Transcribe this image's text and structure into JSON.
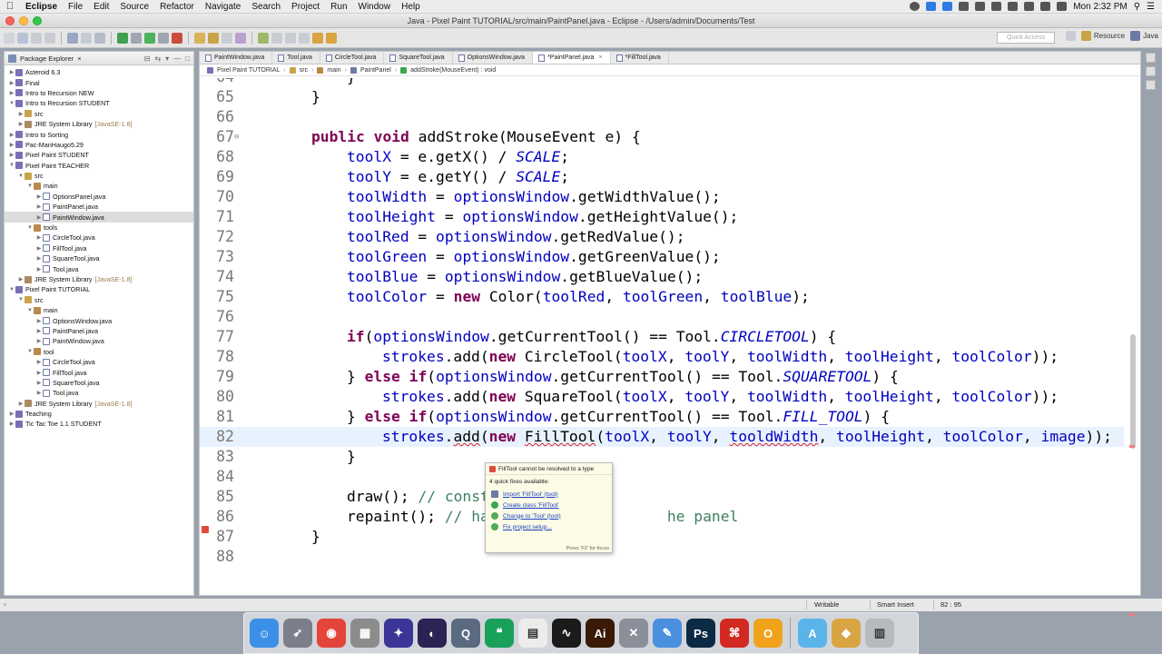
{
  "menubar": {
    "app_name": "Eclipse",
    "items": [
      "File",
      "Edit",
      "Source",
      "Refactor",
      "Navigate",
      "Search",
      "Project",
      "Run",
      "Window",
      "Help"
    ],
    "clock": "Mon 2:32 PM"
  },
  "window": {
    "title": "Java - Pixel Paint TUTORIAL/src/main/PaintPanel.java - Eclipse - /Users/admin/Documents/Test"
  },
  "toolbar": {
    "quick_access_placeholder": "Quick Access",
    "perspectives": [
      "Resource",
      "Java"
    ]
  },
  "explorer": {
    "title": "Package Explorer",
    "rows": [
      {
        "depth": 0,
        "arrow": "▶",
        "icon": "project",
        "label": "Asteroid 6.3"
      },
      {
        "depth": 0,
        "arrow": "▶",
        "icon": "project",
        "label": "Final"
      },
      {
        "depth": 0,
        "arrow": "▶",
        "icon": "project",
        "label": "Intro to Recursion NEW"
      },
      {
        "depth": 0,
        "arrow": "▼",
        "icon": "project",
        "label": "Intro to Recursion STUDENT"
      },
      {
        "depth": 1,
        "arrow": "▶",
        "icon": "folder",
        "label": "src"
      },
      {
        "depth": 1,
        "arrow": "▶",
        "icon": "lib",
        "label": "JRE System Library",
        "suffix": "[JavaSE-1.8]"
      },
      {
        "depth": 0,
        "arrow": "▶",
        "icon": "project",
        "label": "Intro to Sorting"
      },
      {
        "depth": 0,
        "arrow": "▶",
        "icon": "project",
        "label": "Pac-ManHaugo5.29"
      },
      {
        "depth": 0,
        "arrow": "▶",
        "icon": "project",
        "label": "Pixel Paint STUDENT"
      },
      {
        "depth": 0,
        "arrow": "▼",
        "icon": "project",
        "label": "Pixel Paint TEACHER"
      },
      {
        "depth": 1,
        "arrow": "▼",
        "icon": "folder",
        "label": "src"
      },
      {
        "depth": 2,
        "arrow": "▼",
        "icon": "package",
        "label": "main"
      },
      {
        "depth": 3,
        "arrow": "▶",
        "icon": "java",
        "label": "OptionsPanel.java"
      },
      {
        "depth": 3,
        "arrow": "▶",
        "icon": "java",
        "label": "PaintPanel.java"
      },
      {
        "depth": 3,
        "arrow": "▶",
        "icon": "java",
        "label": "PaintWindow.java",
        "selected": true
      },
      {
        "depth": 2,
        "arrow": "▼",
        "icon": "package",
        "label": "tools"
      },
      {
        "depth": 3,
        "arrow": "▶",
        "icon": "java",
        "label": "CircleTool.java"
      },
      {
        "depth": 3,
        "arrow": "▶",
        "icon": "java",
        "label": "FillTool.java"
      },
      {
        "depth": 3,
        "arrow": "▶",
        "icon": "java",
        "label": "SquareTool.java"
      },
      {
        "depth": 3,
        "arrow": "▶",
        "icon": "java",
        "label": "Tool.java"
      },
      {
        "depth": 1,
        "arrow": "▶",
        "icon": "lib",
        "label": "JRE System Library",
        "suffix": "[JavaSE-1.8]"
      },
      {
        "depth": 0,
        "arrow": "▼",
        "icon": "project",
        "label": "Pixel Paint TUTORIAL"
      },
      {
        "depth": 1,
        "arrow": "▼",
        "icon": "folder",
        "label": "src"
      },
      {
        "depth": 2,
        "arrow": "▼",
        "icon": "package",
        "label": "main"
      },
      {
        "depth": 3,
        "arrow": "▶",
        "icon": "java",
        "label": "OptionsWindow.java"
      },
      {
        "depth": 3,
        "arrow": "▶",
        "icon": "java",
        "label": "PaintPanel.java"
      },
      {
        "depth": 3,
        "arrow": "▶",
        "icon": "java",
        "label": "PaintWindow.java"
      },
      {
        "depth": 2,
        "arrow": "▼",
        "icon": "package",
        "label": "tool"
      },
      {
        "depth": 3,
        "arrow": "▶",
        "icon": "java",
        "label": "CircleTool.java"
      },
      {
        "depth": 3,
        "arrow": "▶",
        "icon": "java",
        "label": "FillTool.java"
      },
      {
        "depth": 3,
        "arrow": "▶",
        "icon": "java",
        "label": "SquareTool.java"
      },
      {
        "depth": 3,
        "arrow": "▶",
        "icon": "java",
        "label": "Tool.java"
      },
      {
        "depth": 1,
        "arrow": "▶",
        "icon": "lib",
        "label": "JRE System Library",
        "suffix": "[JavaSE-1.8]"
      },
      {
        "depth": 0,
        "arrow": "▶",
        "icon": "project",
        "label": "Teaching"
      },
      {
        "depth": 0,
        "arrow": "▶",
        "icon": "project",
        "label": "Tic Tac Toe 1.1 STUDENT"
      }
    ]
  },
  "editor": {
    "tabs": [
      {
        "label": "PaintWindow.java",
        "active": false
      },
      {
        "label": "Tool.java",
        "active": false
      },
      {
        "label": "CircleTool.java",
        "active": false
      },
      {
        "label": "SquareTool.java",
        "active": false
      },
      {
        "label": "OptionsWindow.java",
        "active": false
      },
      {
        "label": "*PaintPanel.java",
        "active": true
      },
      {
        "label": "*FillTool.java",
        "active": false
      }
    ],
    "breadcrumb": [
      "Pixel Paint TUTORIAL",
      "src",
      "main",
      "PaintPanel",
      "addStroke(MouseEvent) : void"
    ],
    "lines": [
      {
        "n": "64",
        "indent": 2,
        "tokens": [
          [
            "",
            "}"
          ]
        ]
      },
      {
        "n": "65",
        "indent": 1,
        "tokens": [
          [
            "",
            "}"
          ]
        ]
      },
      {
        "n": "66",
        "indent": 0,
        "tokens": []
      },
      {
        "n": "67",
        "indent": 1,
        "fold": true,
        "tokens": [
          [
            "kw",
            "public"
          ],
          [
            "",
            " "
          ],
          [
            "kw",
            "void"
          ],
          [
            "",
            " addStroke(MouseEvent e) {"
          ]
        ]
      },
      {
        "n": "68",
        "indent": 2,
        "tokens": [
          [
            "fld",
            "toolX"
          ],
          [
            "",
            " = e.getX() / "
          ],
          [
            "stat",
            "SCALE"
          ],
          [
            "",
            ";"
          ]
        ]
      },
      {
        "n": "69",
        "indent": 2,
        "tokens": [
          [
            "fld",
            "toolY"
          ],
          [
            "",
            " = e.getY() / "
          ],
          [
            "stat",
            "SCALE"
          ],
          [
            "",
            ";"
          ]
        ]
      },
      {
        "n": "70",
        "indent": 2,
        "tokens": [
          [
            "fld",
            "toolWidth"
          ],
          [
            "",
            " = "
          ],
          [
            "fld",
            "optionsWindow"
          ],
          [
            "",
            ".getWidthValue();"
          ]
        ]
      },
      {
        "n": "71",
        "indent": 2,
        "tokens": [
          [
            "fld",
            "toolHeight"
          ],
          [
            "",
            " = "
          ],
          [
            "fld",
            "optionsWindow"
          ],
          [
            "",
            ".getHeightValue();"
          ]
        ]
      },
      {
        "n": "72",
        "indent": 2,
        "tokens": [
          [
            "fld",
            "toolRed"
          ],
          [
            "",
            " = "
          ],
          [
            "fld",
            "optionsWindow"
          ],
          [
            "",
            ".getRedValue();"
          ]
        ]
      },
      {
        "n": "73",
        "indent": 2,
        "tokens": [
          [
            "fld",
            "toolGreen"
          ],
          [
            "",
            " = "
          ],
          [
            "fld",
            "optionsWindow"
          ],
          [
            "",
            ".getGreenValue();"
          ]
        ]
      },
      {
        "n": "74",
        "indent": 2,
        "tokens": [
          [
            "fld",
            "toolBlue"
          ],
          [
            "",
            " = "
          ],
          [
            "fld",
            "optionsWindow"
          ],
          [
            "",
            ".getBlueValue();"
          ]
        ]
      },
      {
        "n": "75",
        "indent": 2,
        "tokens": [
          [
            "fld",
            "toolColor"
          ],
          [
            "",
            " = "
          ],
          [
            "kw",
            "new"
          ],
          [
            "",
            " Color("
          ],
          [
            "fld",
            "toolRed"
          ],
          [
            "",
            ", "
          ],
          [
            "fld",
            "toolGreen"
          ],
          [
            "",
            ", "
          ],
          [
            "fld",
            "toolBlue"
          ],
          [
            "",
            ");"
          ]
        ]
      },
      {
        "n": "76",
        "indent": 0,
        "tokens": []
      },
      {
        "n": "77",
        "indent": 2,
        "tokens": [
          [
            "kw",
            "if"
          ],
          [
            "",
            "("
          ],
          [
            "fld",
            "optionsWindow"
          ],
          [
            "",
            ".getCurrentTool() == Tool."
          ],
          [
            "stat",
            "CIRCLETOOL"
          ],
          [
            "",
            ") {"
          ]
        ]
      },
      {
        "n": "78",
        "indent": 3,
        "tokens": [
          [
            "fld",
            "strokes"
          ],
          [
            "",
            ".add("
          ],
          [
            "kw",
            "new"
          ],
          [
            "",
            " CircleTool("
          ],
          [
            "fld",
            "toolX"
          ],
          [
            "",
            ", "
          ],
          [
            "fld",
            "toolY"
          ],
          [
            "",
            ", "
          ],
          [
            "fld",
            "toolWidth"
          ],
          [
            "",
            ", "
          ],
          [
            "fld",
            "toolHeight"
          ],
          [
            "",
            ", "
          ],
          [
            "fld",
            "toolColor"
          ],
          [
            "",
            "));"
          ]
        ]
      },
      {
        "n": "79",
        "indent": 2,
        "tokens": [
          [
            "",
            "} "
          ],
          [
            "kw",
            "else"
          ],
          [
            "",
            " "
          ],
          [
            "kw",
            "if"
          ],
          [
            "",
            "("
          ],
          [
            "fld",
            "optionsWindow"
          ],
          [
            "",
            ".getCurrentTool() == Tool."
          ],
          [
            "stat",
            "SQUARETOOL"
          ],
          [
            "",
            ") {"
          ]
        ]
      },
      {
        "n": "80",
        "indent": 3,
        "tokens": [
          [
            "fld",
            "strokes"
          ],
          [
            "",
            ".add("
          ],
          [
            "kw",
            "new"
          ],
          [
            "",
            " SquareTool("
          ],
          [
            "fld",
            "toolX"
          ],
          [
            "",
            ", "
          ],
          [
            "fld",
            "toolY"
          ],
          [
            "",
            ", "
          ],
          [
            "fld",
            "toolWidth"
          ],
          [
            "",
            ", "
          ],
          [
            "fld",
            "toolHeight"
          ],
          [
            "",
            ", "
          ],
          [
            "fld",
            "toolColor"
          ],
          [
            "",
            "));"
          ]
        ]
      },
      {
        "n": "81",
        "indent": 2,
        "tokens": [
          [
            "",
            "} "
          ],
          [
            "kw",
            "else"
          ],
          [
            "",
            " "
          ],
          [
            "kw",
            "if"
          ],
          [
            "",
            "("
          ],
          [
            "fld",
            "optionsWindow"
          ],
          [
            "",
            ".getCurrentTool() == Tool."
          ],
          [
            "stat",
            "FILL_TOOL"
          ],
          [
            "",
            ") {"
          ]
        ]
      },
      {
        "n": "82",
        "indent": 3,
        "current": true,
        "error": true,
        "tokens": [
          [
            "fld",
            "strokes"
          ],
          [
            "",
            "."
          ],
          [
            "err",
            "add"
          ],
          [
            "",
            "("
          ],
          [
            "kw",
            "new"
          ],
          [
            "",
            " "
          ],
          [
            "err",
            "FillTool"
          ],
          [
            "",
            "("
          ],
          [
            "fld",
            "toolX"
          ],
          [
            "",
            ", "
          ],
          [
            "fld",
            "toolY"
          ],
          [
            "",
            ", "
          ],
          [
            "err fld",
            "tooldWidth"
          ],
          [
            "",
            ", "
          ],
          [
            "fld",
            "toolHeight"
          ],
          [
            "",
            ", "
          ],
          [
            "fld",
            "toolColor"
          ],
          [
            "",
            ", "
          ],
          [
            "fld",
            "image"
          ],
          [
            "",
            "));"
          ]
        ]
      },
      {
        "n": "83",
        "indent": 2,
        "tokens": [
          [
            "",
            "}"
          ]
        ]
      },
      {
        "n": "84",
        "indent": 0,
        "tokens": []
      },
      {
        "n": "85",
        "indent": 2,
        "tokens": [
          [
            "",
            "draw(); "
          ],
          [
            "cm",
            "// construct"
          ]
        ]
      },
      {
        "n": "86",
        "indent": 2,
        "tokens": [
          [
            "",
            "repaint(); "
          ],
          [
            "cm",
            "// hangs                 he panel"
          ]
        ]
      },
      {
        "n": "87",
        "indent": 1,
        "tokens": [
          [
            "",
            "}"
          ]
        ]
      },
      {
        "n": "88",
        "indent": 0,
        "tokens": []
      }
    ]
  },
  "quickfix": {
    "title": "FillTool cannot be resolved to a type",
    "subtitle": "4 quick fixes available:",
    "fixes": [
      "Import 'FillTool' (tool)",
      "Create class 'FillTool'",
      "Change to 'Tool' (tool)",
      "Fix project setup..."
    ],
    "footer": "Press 'F2' for focus"
  },
  "statusbar": {
    "mode": "Writable",
    "insert": "Smart Insert",
    "position": "82 : 95"
  },
  "dock": {
    "apps": [
      {
        "name": "finder",
        "label": "☺",
        "color": "#3b8fe6"
      },
      {
        "name": "launchpad",
        "label": "➶",
        "color": "#7a7f8a"
      },
      {
        "name": "chrome",
        "label": "◉",
        "color": "#e4453a"
      },
      {
        "name": "calculator",
        "label": "▦",
        "color": "#8c8c8c"
      },
      {
        "name": "eclipse-star",
        "label": "✦",
        "color": "#3a3596"
      },
      {
        "name": "eclipse",
        "label": "◐",
        "color": "#2c2255"
      },
      {
        "name": "quicktime",
        "label": "Q",
        "color": "#5a6a80"
      },
      {
        "name": "hangouts",
        "label": "❝",
        "color": "#19a05a"
      },
      {
        "name": "grid-app",
        "label": "▤",
        "color": "#ececec"
      },
      {
        "name": "activity-monitor",
        "label": "∿",
        "color": "#1b1b1b"
      },
      {
        "name": "illustrator",
        "label": "Ai",
        "color": "#3a1a06"
      },
      {
        "name": "utilities",
        "label": "✕",
        "color": "#8a8f99"
      },
      {
        "name": "text-edit",
        "label": "✎",
        "color": "#4a8fe0"
      },
      {
        "name": "photoshop",
        "label": "Ps",
        "color": "#0d2a44"
      },
      {
        "name": "acrobat",
        "label": "⌘",
        "color": "#d22a22"
      },
      {
        "name": "outlook",
        "label": "O",
        "color": "#f0a21a"
      },
      {
        "name": "applications-folder",
        "label": "A",
        "color": "#5ab4ea"
      },
      {
        "name": "archive",
        "label": "◆",
        "color": "#d9a442"
      },
      {
        "name": "trash",
        "label": "▥",
        "color": "#b6b9be"
      }
    ]
  }
}
